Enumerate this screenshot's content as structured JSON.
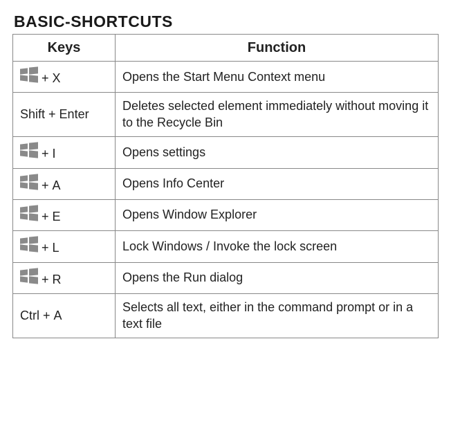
{
  "title": "BASIC-SHORTCUTS",
  "headers": {
    "keys": "Keys",
    "func": "Function"
  },
  "rows": [
    {
      "keys": [
        {
          "t": "win"
        },
        {
          "t": "plus"
        },
        {
          "t": "text",
          "v": "X"
        }
      ],
      "func": "Opens the Start Menu Context menu"
    },
    {
      "keys": [
        {
          "t": "text",
          "v": "Shift"
        },
        {
          "t": "plus"
        },
        {
          "t": "text",
          "v": "Enter"
        }
      ],
      "func": "Deletes selected element immediately without mo­ving it to the Recycle Bin"
    },
    {
      "keys": [
        {
          "t": "win"
        },
        {
          "t": "plus"
        },
        {
          "t": "text",
          "v": "I"
        }
      ],
      "func": "Opens settings"
    },
    {
      "keys": [
        {
          "t": "win"
        },
        {
          "t": "plus"
        },
        {
          "t": "text",
          "v": "A"
        }
      ],
      "func": "Opens Info Center"
    },
    {
      "keys": [
        {
          "t": "win"
        },
        {
          "t": "plus"
        },
        {
          "t": "text",
          "v": "E"
        }
      ],
      "func": "Opens Window Explorer"
    },
    {
      "keys": [
        {
          "t": "win"
        },
        {
          "t": "plus"
        },
        {
          "t": "text",
          "v": "L"
        }
      ],
      "func": "Lock Windows / Invoke the lock screen"
    },
    {
      "keys": [
        {
          "t": "win"
        },
        {
          "t": "plus"
        },
        {
          "t": "text",
          "v": "R"
        }
      ],
      "func": "Opens the Run dialog"
    },
    {
      "keys": [
        {
          "t": "text",
          "v": "Ctrl"
        },
        {
          "t": "plus"
        },
        {
          "t": "text",
          "v": "A"
        }
      ],
      "func": "Selects all text, either in the command prompt or in a text file"
    }
  ]
}
